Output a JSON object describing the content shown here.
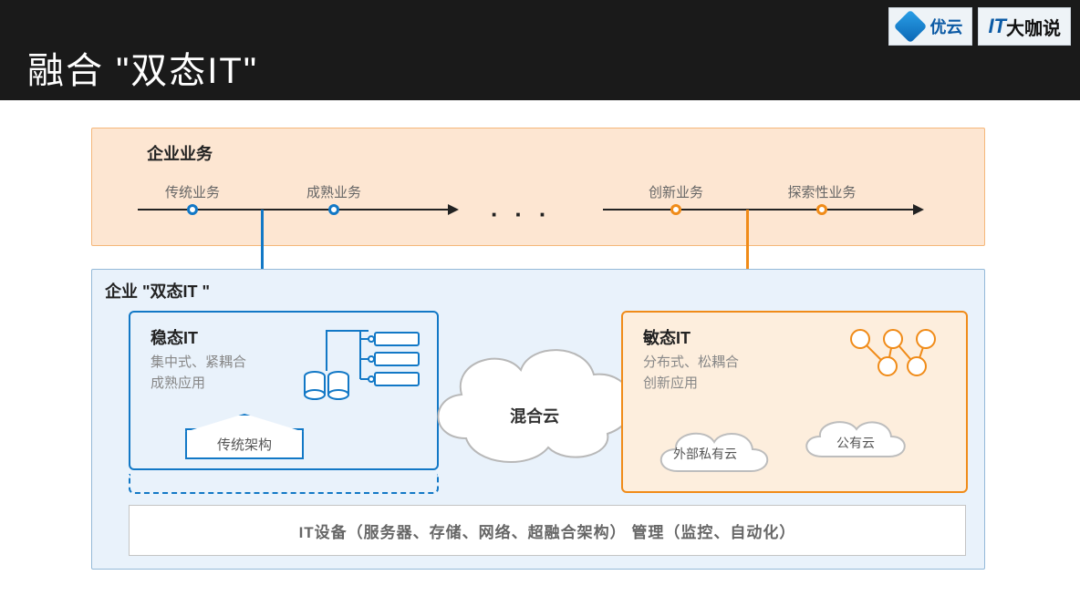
{
  "header": {
    "title": "融合 \"双态IT\"",
    "logo1": "优云",
    "logo2_brand": "IT",
    "logo2_text": "大咖说"
  },
  "biz": {
    "title": "企业业务",
    "left_items": [
      "传统业务",
      "成熟业务"
    ],
    "right_items": [
      "创新业务",
      "探索性业务"
    ]
  },
  "it": {
    "title": "企业 \"双态IT \"",
    "stable": {
      "heading": "稳态IT",
      "line1": "集中式、紧耦合",
      "line2": "成熟应用",
      "legacy": "传统架构"
    },
    "agile": {
      "heading": "敏态IT",
      "line1": "分布式、松耦合",
      "line2": "创新应用",
      "cloud1": "外部私有云",
      "cloud2": "公有云"
    },
    "hybrid": "混合云",
    "footer": "IT设备（服务器、存储、网络、超融合架构）   管理（监控、自动化）"
  },
  "colors": {
    "blue": "#1278c6",
    "orange": "#f08b18"
  }
}
